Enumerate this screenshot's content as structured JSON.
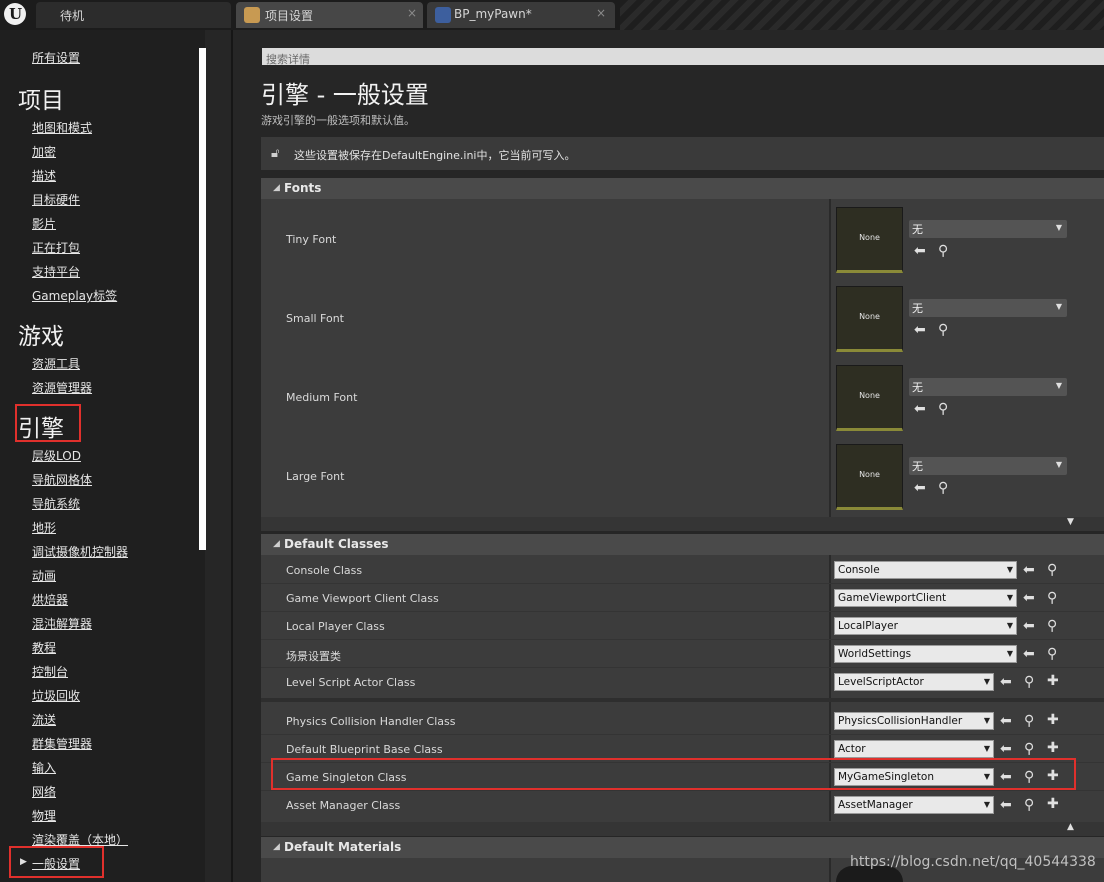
{
  "tabs": [
    {
      "label": "待机",
      "close": ""
    },
    {
      "label": "项目设置",
      "close": "×"
    },
    {
      "label": "BP_myPawn*",
      "close": "×"
    }
  ],
  "sidebar": {
    "all_settings": "所有设置",
    "groups": [
      {
        "title": "项目",
        "items": [
          "地图和模式",
          "加密",
          "描述",
          "目标硬件",
          "影片",
          "正在打包",
          "支持平台",
          "Gameplay标签"
        ]
      },
      {
        "title": "游戏",
        "items": [
          "资源工具",
          "资源管理器"
        ]
      },
      {
        "title": "引擎",
        "items": [
          "层级LOD",
          "导航网格体",
          "导航系统",
          "地形",
          "调试摄像机控制器",
          "动画",
          "烘焙器",
          "混沌解算器",
          "教程",
          "控制台",
          "垃圾回收",
          "流送",
          "群集管理器",
          "输入",
          "网络",
          "物理",
          "渲染覆盖（本地）",
          "一般设置"
        ]
      }
    ]
  },
  "search": {
    "placeholder": "搜索详情"
  },
  "page": {
    "title": "引擎 - 一般设置",
    "description": "游戏引擎的一般选项和默认值。",
    "notice": "这些设置被保存在DefaultEngine.ini中，它当前可写入。"
  },
  "fonts_section": {
    "title": "Fonts",
    "rows": [
      {
        "label": "Tiny Font",
        "thumb": "None",
        "value": "无"
      },
      {
        "label": "Small Font",
        "thumb": "None",
        "value": "无"
      },
      {
        "label": "Medium Font",
        "thumb": "None",
        "value": "无"
      },
      {
        "label": "Large Font",
        "thumb": "None",
        "value": "无"
      }
    ]
  },
  "classes_section": {
    "title": "Default Classes",
    "rows": [
      {
        "label": "Console Class",
        "value": "Console"
      },
      {
        "label": "Game Viewport Client Class",
        "value": "GameViewportClient"
      },
      {
        "label": "Local Player Class",
        "value": "LocalPlayer"
      },
      {
        "label": "场景设置类",
        "value": "WorldSettings"
      },
      {
        "label": "Level Script Actor Class",
        "value": "LevelScriptActor"
      },
      {
        "label": "Physics Collision Handler Class",
        "value": "PhysicsCollisionHandler"
      },
      {
        "label": "Default Blueprint Base Class",
        "value": "Actor"
      },
      {
        "label": "Game Singleton Class",
        "value": "MyGameSingleton"
      },
      {
        "label": "Asset Manager Class",
        "value": "AssetManager"
      }
    ]
  },
  "materials_section": {
    "title": "Default Materials"
  },
  "watermark": "https://blog.csdn.net/qq_40544338",
  "colors": {
    "highlight": "#e0302c",
    "thumb_border": "#8a8a38"
  }
}
